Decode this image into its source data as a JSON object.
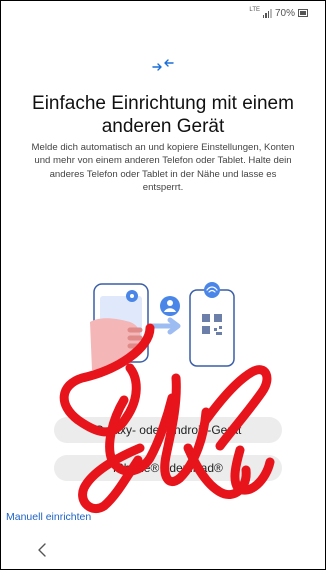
{
  "status_bar": {
    "network_label": "LTE",
    "battery_percent": "70%",
    "icons": [
      "signal-icon",
      "battery-icon"
    ]
  },
  "header": {
    "icon": "transfer-arrows-icon",
    "accent_color": "#1a6fd6"
  },
  "title": "Einfache Einrichtung mit einem anderen Gerät",
  "description": "Melde dich automatisch an und kopiere Einstellungen, Konten und mehr von einem anderen Telefon oder Tablet. Halte dein anderes Telefon oder Tablet in der Nähe und lasse es entsperrt.",
  "buttons": {
    "android": "Galaxy- oder Android-Gerät",
    "iphone": "iPhone® oder iPad®"
  },
  "manual_setup_link": "Manuell einrichten",
  "nav": {
    "back_icon": "chevron-left-icon"
  },
  "overlay": {
    "scribble_color": "#e8141b"
  }
}
